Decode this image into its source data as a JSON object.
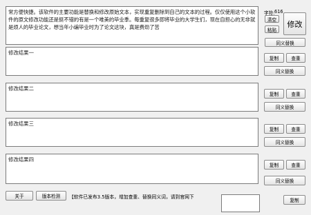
{
  "source": {
    "text": "常方便快捷。该软件的主要功能是替换和修改原始文本，实现重复删除到自己的文本的过程。仅仅使用这个小软件的原文修改功能还是挺不错的有是一个唯美的毕业季。每重复很多即将毕业的大学生们，现在自担心的无非就是烦人的毕业论文，想当年小编毕业时为了论文这块，真是费劲了苦"
  },
  "char_count": {
    "label": "字符:",
    "value": "616"
  },
  "buttons": {
    "clear": "清空",
    "paste": "粘贴",
    "modify": "修改",
    "synonym": "同义替换",
    "copy": "复制",
    "check": "查重"
  },
  "results": [
    {
      "text": "修改结果一"
    },
    {
      "text": "修改结果二"
    },
    {
      "text": "修改结果三"
    },
    {
      "text": "修改结果四"
    }
  ],
  "footer": {
    "about": "关于",
    "version_check": "版本检测",
    "notice": "【软件已发布3.5版本，增加查重、替换同义词，请到官网下"
  }
}
